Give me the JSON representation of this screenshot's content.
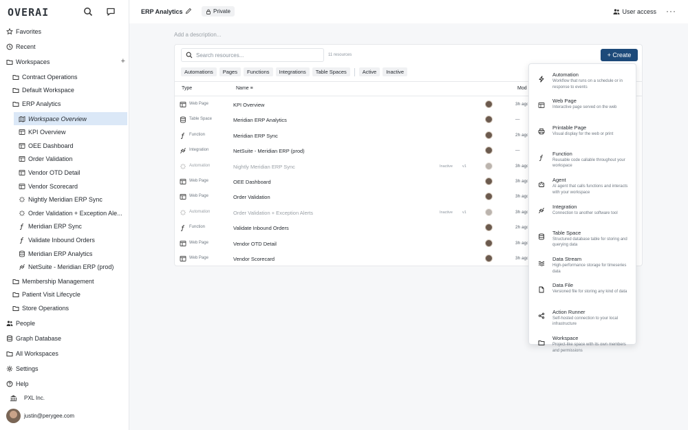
{
  "app": {
    "logo": "OVERAI"
  },
  "sidebar": {
    "top_items": [
      {
        "label": "Favorites",
        "icon": "star-icon"
      },
      {
        "label": "Recent",
        "icon": "clock-icon"
      },
      {
        "label": "Workspaces",
        "icon": "workspaces-icon"
      }
    ],
    "workspaces": [
      "Contract Operations",
      "Default Workspace",
      "ERP Analytics"
    ],
    "erp_children": [
      {
        "label": "Workspace Overview",
        "icon": "map-icon"
      },
      {
        "label": "KPI Overview",
        "icon": "web-page-icon"
      },
      {
        "label": "OEE Dashboard",
        "icon": "web-page-icon"
      },
      {
        "label": "Order Validation",
        "icon": "web-page-icon"
      },
      {
        "label": "Vendor OTD Detail",
        "icon": "web-page-icon"
      },
      {
        "label": "Vendor Scorecard",
        "icon": "web-page-icon"
      },
      {
        "label": "Nightly Meridian ERP Sync",
        "icon": "automation-icon"
      },
      {
        "label": "Order Validation + Exception Ale...",
        "icon": "automation-icon"
      },
      {
        "label": "Meridian ERP Sync",
        "icon": "function-icon"
      },
      {
        "label": "Validate Inbound Orders",
        "icon": "function-icon"
      },
      {
        "label": "Meridian ERP Analytics",
        "icon": "table-space-icon"
      },
      {
        "label": "NetSuite - Meridian ERP (prod)",
        "icon": "integration-icon"
      }
    ],
    "more_workspaces": [
      "Membership Management",
      "Patient Visit Lifecycle",
      "Store Operations"
    ],
    "bottom_items": [
      {
        "label": "People",
        "icon": "people-icon"
      },
      {
        "label": "Graph Database",
        "icon": "database-icon"
      },
      {
        "label": "All Workspaces",
        "icon": "workspaces-icon"
      },
      {
        "label": "Settings",
        "icon": "gear-icon"
      },
      {
        "label": "Help",
        "icon": "help-icon"
      }
    ],
    "org": "PXL Inc.",
    "user_email": "justin@perygee.com"
  },
  "topbar": {
    "title": "ERP Analytics",
    "privacy": "Private",
    "user_access": "User access"
  },
  "description_placeholder": "Add a description...",
  "resources": {
    "search_placeholder": "Search resources...",
    "count": "11 resources",
    "create_label": "+ Create",
    "type_filters": [
      "Automations",
      "Pages",
      "Functions",
      "Integrations",
      "Table Spaces"
    ],
    "status_filters": [
      "Active",
      "Inactive"
    ],
    "columns": {
      "type": "Type",
      "name": "Name",
      "modified": "Mod"
    },
    "rows": [
      {
        "type": "Web Page",
        "name": "KPI Overview",
        "status": "",
        "version": "",
        "modified": "3h ago",
        "inactive": false
      },
      {
        "type": "Table Space",
        "name": "Meridian ERP Analytics",
        "status": "",
        "version": "",
        "modified": "—",
        "inactive": false
      },
      {
        "type": "Function",
        "name": "Meridian ERP Sync",
        "status": "",
        "version": "",
        "modified": "2h ago",
        "inactive": false
      },
      {
        "type": "Integration",
        "name": "NetSuite - Meridian ERP (prod)",
        "status": "",
        "version": "",
        "modified": "—",
        "inactive": false
      },
      {
        "type": "Automation",
        "name": "Nightly Meridian ERP Sync",
        "status": "Inactive",
        "version": "v1",
        "modified": "3h ago",
        "inactive": true
      },
      {
        "type": "Web Page",
        "name": "OEE Dashboard",
        "status": "",
        "version": "",
        "modified": "3h ago",
        "inactive": false
      },
      {
        "type": "Web Page",
        "name": "Order Validation",
        "status": "",
        "version": "",
        "modified": "3h ago",
        "inactive": false
      },
      {
        "type": "Automation",
        "name": "Order Validation + Exception Alerts",
        "status": "Inactive",
        "version": "v1",
        "modified": "3h ago",
        "inactive": true
      },
      {
        "type": "Function",
        "name": "Validate Inbound Orders",
        "status": "",
        "version": "",
        "modified": "2h ago",
        "inactive": false
      },
      {
        "type": "Web Page",
        "name": "Vendor OTD Detail",
        "status": "",
        "version": "",
        "modified": "3h ago",
        "inactive": false
      },
      {
        "type": "Web Page",
        "name": "Vendor Scorecard",
        "status": "",
        "version": "",
        "modified": "3h ago",
        "inactive": false
      }
    ]
  },
  "create_menu": [
    {
      "title": "Automation",
      "desc": "Workflow that runs on a schedule or in response to events",
      "icon": "bolt-icon"
    },
    {
      "title": "Web Page",
      "desc": "Interactive page served on the web",
      "icon": "web-page-icon"
    },
    {
      "title": "Printable Page",
      "desc": "Visual display for the web or print",
      "icon": "printer-icon"
    },
    {
      "title": "Function",
      "desc": "Reusable code callable throughout your workspace",
      "icon": "function-icon"
    },
    {
      "title": "Agent",
      "desc": "AI agent that calls functions and interacts with your workspace",
      "icon": "robot-icon"
    },
    {
      "title": "Integration",
      "desc": "Connection to another software tool",
      "icon": "plug-icon"
    },
    {
      "title": "Table Space",
      "desc": "Structured database table for storing and querying data",
      "icon": "database-icon"
    },
    {
      "title": "Data Stream",
      "desc": "High-performance storage for timeseries data",
      "icon": "stream-icon"
    },
    {
      "title": "Data File",
      "desc": "Versioned file for storing any kind of data",
      "icon": "file-icon"
    },
    {
      "title": "Action Runner",
      "desc": "Self-hosted connection to your local infrastructure",
      "icon": "share-icon"
    },
    {
      "title": "Workspace",
      "desc": "Project-like space with its own members and permissions",
      "icon": "folder-icon"
    }
  ]
}
